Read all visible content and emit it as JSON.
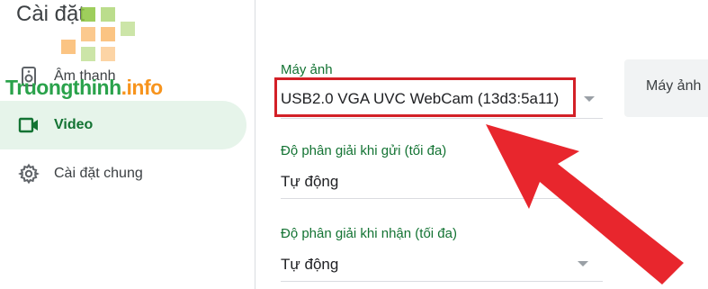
{
  "page": {
    "title": "Cài đặt"
  },
  "watermark": {
    "part1": "Truongthinh",
    "part2": ".info"
  },
  "sidebar": {
    "items": [
      {
        "label": "Âm thanh",
        "icon": "speaker-icon",
        "active": false
      },
      {
        "label": "Video",
        "icon": "video-camera-icon",
        "active": true
      },
      {
        "label": "Cài đặt chung",
        "icon": "gear-icon",
        "active": false
      }
    ]
  },
  "main": {
    "camera": {
      "label": "Máy ảnh",
      "value": "USB2.0 VGA UVC WebCam (13d3:5a11)"
    },
    "preview": {
      "label": "Máy ảnh"
    },
    "send_resolution": {
      "label": "Độ phân giải khi gửi (tối đa)",
      "value": "Tự động"
    },
    "receive_resolution": {
      "label": "Độ phân giải khi nhận (tối đa)",
      "value": "Tự động"
    }
  },
  "colors": {
    "accent_green": "#137333",
    "active_bg": "#e6f4ea",
    "highlight_red": "#d32027",
    "arrow_red": "#e8262d"
  }
}
